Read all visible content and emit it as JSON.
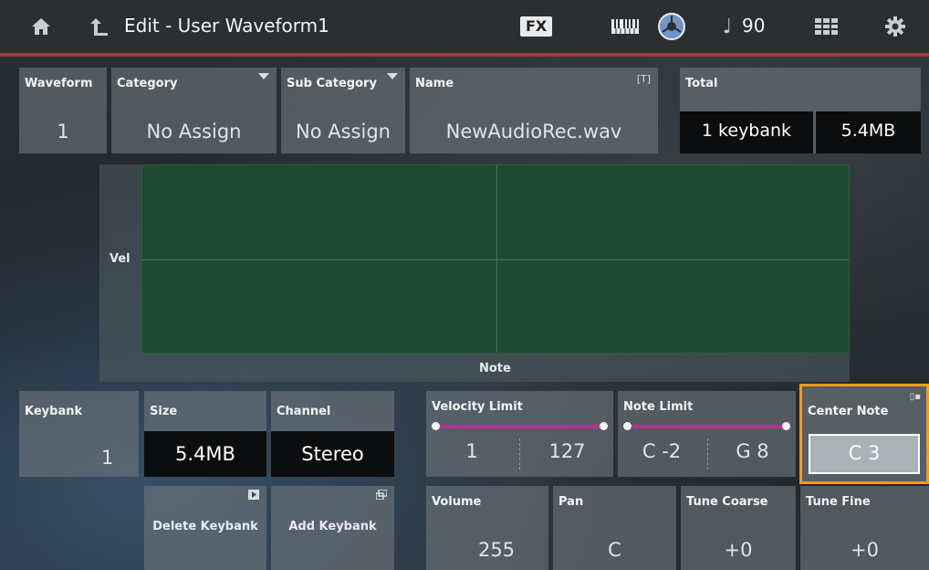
{
  "topbar": {
    "title": "Edit - User Waveform1",
    "fx_label": "FX",
    "tempo_value": "90",
    "icons": [
      "home-icon",
      "up-arrow-icon",
      "fx-badge",
      "keyboard-icon",
      "yamaha-logo-icon",
      "note-icon",
      "grid-icon",
      "gear-icon"
    ]
  },
  "waveform": {
    "label": "Waveform",
    "value": "1"
  },
  "category": {
    "label": "Category",
    "value": "No Assign"
  },
  "sub_category": {
    "label": "Sub Category",
    "value": "No Assign"
  },
  "name": {
    "label": "Name",
    "value": "NewAudioRec.wav",
    "tag": "[T]"
  },
  "total": {
    "label": "Total",
    "keybanks": "1 keybank",
    "size": "5.4MB"
  },
  "graph": {
    "y_label": "Vel",
    "x_label": "Note"
  },
  "keybank": {
    "label": "Keybank",
    "value": "1"
  },
  "size": {
    "label": "Size",
    "value": "5.4MB"
  },
  "channel": {
    "label": "Channel",
    "value": "Stereo"
  },
  "velocity_limit": {
    "label": "Velocity Limit",
    "low": "1",
    "high": "127"
  },
  "note_limit": {
    "label": "Note Limit",
    "low": "C -2",
    "high": "G 8"
  },
  "center_note": {
    "label": "Center Note",
    "value": "C 3"
  },
  "buttons": {
    "delete_keybank": "Delete Keybank",
    "add_keybank": "Add Keybank"
  },
  "volume": {
    "label": "Volume",
    "value": "255"
  },
  "pan": {
    "label": "Pan",
    "value": "C"
  },
  "tune_coarse": {
    "label": "Tune Coarse",
    "value": "+0"
  },
  "tune_fine": {
    "label": "Tune Fine",
    "value": "+0"
  },
  "colors": {
    "accent_red": "#9c3c3c",
    "selection_orange": "#f09a20",
    "range_magenta": "#b5338f",
    "graph_green": "#1e4b30"
  }
}
